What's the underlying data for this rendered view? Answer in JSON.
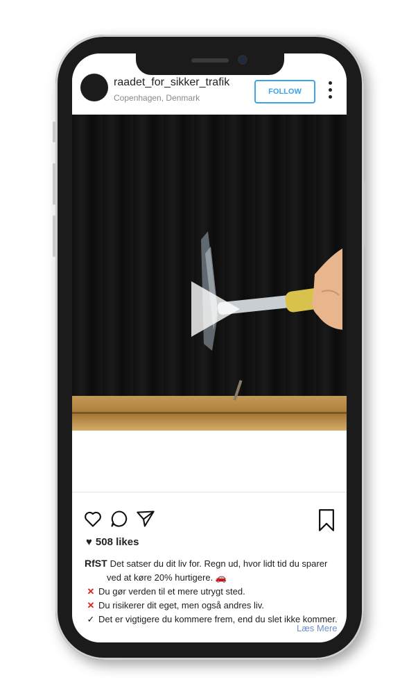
{
  "post": {
    "username": "raadet_for_sikker_trafik",
    "location": "Copenhagen, Denmark",
    "follow_label": "FOLLOW"
  },
  "likes": {
    "count_text": "508 likes"
  },
  "caption": {
    "author": "RfST",
    "intro": "Det satser du dit liv for. Regn ud, hvor lidt tid du sparer",
    "intro_cont": "ved at køre 20% hurtigere.",
    "intro_emoji": "🚗",
    "points": [
      {
        "mark": "✕",
        "text": "Du gør verden til et mere utrygt sted."
      },
      {
        "mark": "✕",
        "text": "Du risikerer dit eget, men også andres liv."
      },
      {
        "mark": "✓",
        "text": "Det er vigtigere du kommere frem, end du slet ikke kommer."
      }
    ],
    "read_more": "Læs Mere"
  },
  "icons": {
    "like": "heart-outline-icon",
    "comment": "comment-bubble-icon",
    "share": "paper-plane-icon",
    "save": "bookmark-icon",
    "more": "vertical-dots-icon",
    "play": "play-icon"
  },
  "colors": {
    "accent": "#3ba3ea",
    "error_mark": "#d9251d",
    "link": "#6b8fc8"
  }
}
